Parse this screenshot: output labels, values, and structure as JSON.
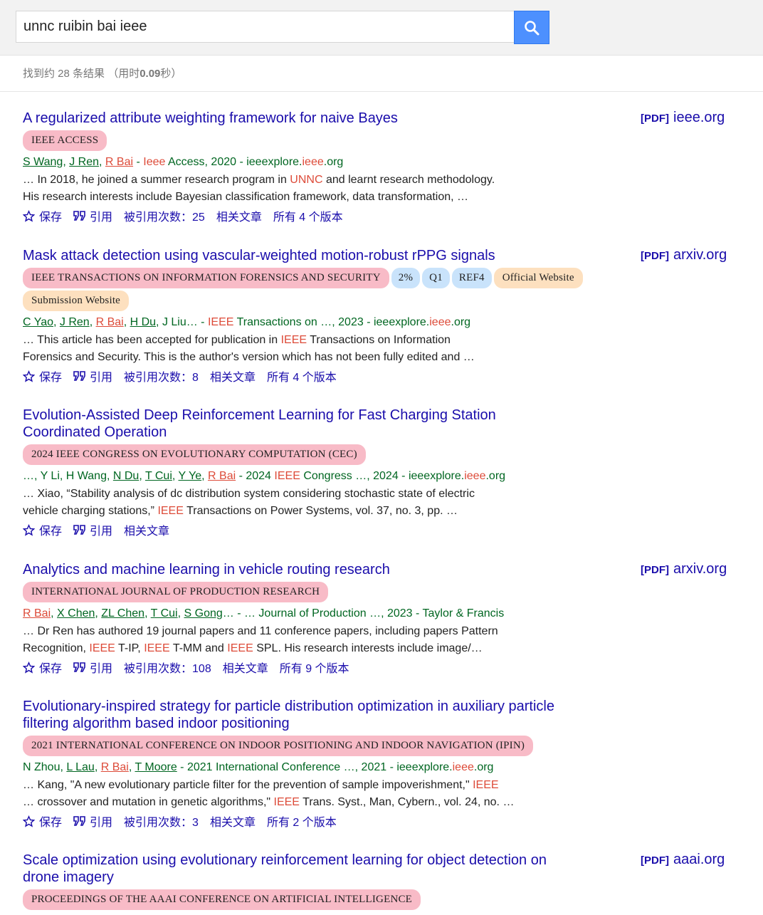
{
  "search": {
    "query": "unnc ruibin bai ieee"
  },
  "stats": {
    "prefix": "找到约 28 条结果 （用时",
    "time": "0.09",
    "suffix": "秒）"
  },
  "actions": {
    "save": "保存",
    "cite": "引用",
    "related": "相关文章"
  },
  "results": [
    {
      "title": "A regularized attribute weighting framework for naive Bayes",
      "pdf_tag": "[PDF]",
      "pdf_domain": "ieee.org",
      "badges": [
        {
          "text": "IEEE ACCESS",
          "color": "pink"
        }
      ],
      "authors": [
        {
          "t": "S Wang",
          "u": true
        },
        {
          "t": ", "
        },
        {
          "t": "J Ren",
          "u": true
        },
        {
          "t": ", "
        },
        {
          "t": "R Bai",
          "u": true,
          "hl": true
        },
        {
          "t": " - "
        },
        {
          "t": "Ieee",
          "hl": true
        },
        {
          "t": " Access, 2020 - ieeexplore."
        },
        {
          "t": "ieee",
          "hl": true
        },
        {
          "t": ".org"
        }
      ],
      "snippet": [
        [
          {
            "t": "… In 2018, he joined a summer research program in "
          },
          {
            "t": "UNNC",
            "hl": true
          },
          {
            "t": " and learnt research methodology."
          }
        ],
        [
          {
            "t": "His research interests include Bayesian classification framework, data transformation, …"
          }
        ]
      ],
      "cited": "被引用次数：25",
      "versions": "所有 4 个版本"
    },
    {
      "title": "Mask attack detection using vascular-weighted motion-robust rPPG signals",
      "pdf_tag": "[PDF]",
      "pdf_domain": "arxiv.org",
      "badges": [
        {
          "text": "IEEE TRANSACTIONS ON INFORMATION FORENSICS AND SECURITY",
          "color": "pink"
        },
        {
          "text": "2%",
          "color": "blue"
        },
        {
          "text": "Q1",
          "color": "blue"
        },
        {
          "text": "REF4",
          "color": "blue"
        },
        {
          "text": "Official Website",
          "color": "orange"
        },
        {
          "text": "Submission Website",
          "color": "orange"
        }
      ],
      "authors": [
        {
          "t": "C Yao",
          "u": true
        },
        {
          "t": ", "
        },
        {
          "t": "J Ren",
          "u": true
        },
        {
          "t": ", "
        },
        {
          "t": "R Bai",
          "u": true,
          "hl": true
        },
        {
          "t": ", "
        },
        {
          "t": "H Du",
          "u": true
        },
        {
          "t": ", J Liu… - "
        },
        {
          "t": "IEEE",
          "hl": true
        },
        {
          "t": " Transactions on …, 2023 - ieeexplore."
        },
        {
          "t": "ieee",
          "hl": true
        },
        {
          "t": ".org"
        }
      ],
      "snippet": [
        [
          {
            "t": "… This article has been accepted for publication in "
          },
          {
            "t": "IEEE",
            "hl": true
          },
          {
            "t": " Transactions on Information"
          }
        ],
        [
          {
            "t": "Forensics and Security. This is the author's version which has not been fully edited and …"
          }
        ]
      ],
      "cited": "被引用次数：8",
      "versions": "所有 4 个版本"
    },
    {
      "title": "Evolution-Assisted Deep Reinforcement Learning for Fast Charging Station Coordinated Operation",
      "pdf_tag": "",
      "pdf_domain": "",
      "badges": [
        {
          "text": "2024 IEEE CONGRESS ON EVOLUTIONARY COMPUTATION (CEC)",
          "color": "pink"
        }
      ],
      "authors": [
        {
          "t": "…, Y Li, H Wang, "
        },
        {
          "t": "N Du",
          "u": true
        },
        {
          "t": ", "
        },
        {
          "t": "T Cui",
          "u": true
        },
        {
          "t": ", "
        },
        {
          "t": "Y Ye",
          "u": true
        },
        {
          "t": ", "
        },
        {
          "t": "R Bai",
          "u": true,
          "hl": true
        },
        {
          "t": " - 2024 "
        },
        {
          "t": "IEEE",
          "hl": true
        },
        {
          "t": " Congress …, 2024 - ieeexplore."
        },
        {
          "t": "ieee",
          "hl": true
        },
        {
          "t": ".org"
        }
      ],
      "snippet": [
        [
          {
            "t": "… Xiao, “Stability analysis of dc distribution system considering stochastic state of electric"
          }
        ],
        [
          {
            "t": "vehicle charging stations,” "
          },
          {
            "t": "IEEE",
            "hl": true
          },
          {
            "t": " Transactions on Power Systems, vol. 37, no. 3, pp. …"
          }
        ]
      ],
      "cited": "",
      "versions": ""
    },
    {
      "title": "Analytics and machine learning in vehicle routing research",
      "pdf_tag": "[PDF]",
      "pdf_domain": "arxiv.org",
      "badges": [
        {
          "text": "INTERNATIONAL JOURNAL OF PRODUCTION RESEARCH",
          "color": "pink"
        }
      ],
      "authors": [
        {
          "t": "R Bai",
          "u": true,
          "hl": true
        },
        {
          "t": ", "
        },
        {
          "t": "X Chen",
          "u": true
        },
        {
          "t": ", "
        },
        {
          "t": "ZL Chen",
          "u": true
        },
        {
          "t": ", "
        },
        {
          "t": "T Cui",
          "u": true
        },
        {
          "t": ", "
        },
        {
          "t": "S Gong",
          "u": true
        },
        {
          "t": "… - … Journal of Production …, 2023 - Taylor & Francis"
        }
      ],
      "snippet": [
        [
          {
            "t": "… Dr Ren has authored 19 journal papers and 11 conference papers, including papers Pattern"
          }
        ],
        [
          {
            "t": "Recognition, "
          },
          {
            "t": "IEEE",
            "hl": true
          },
          {
            "t": " T-IP, "
          },
          {
            "t": "IEEE",
            "hl": true
          },
          {
            "t": " T-MM and "
          },
          {
            "t": "IEEE",
            "hl": true
          },
          {
            "t": " SPL. His research interests include image/…"
          }
        ]
      ],
      "cited": "被引用次数：108",
      "versions": "所有 9 个版本"
    },
    {
      "title": "Evolutionary-inspired strategy for particle distribution optimization in auxiliary particle filtering algorithm based indoor positioning",
      "pdf_tag": "",
      "pdf_domain": "",
      "badges": [
        {
          "text": "2021 INTERNATIONAL CONFERENCE ON INDOOR POSITIONING AND INDOOR NAVIGATION (IPIN)",
          "color": "pink"
        }
      ],
      "authors": [
        {
          "t": "N Zhou, "
        },
        {
          "t": "L Lau",
          "u": true
        },
        {
          "t": ", "
        },
        {
          "t": "R Bai",
          "u": true,
          "hl": true
        },
        {
          "t": ", "
        },
        {
          "t": "T Moore",
          "u": true
        },
        {
          "t": " - 2021 International Conference …, 2021 - ieeexplore."
        },
        {
          "t": "ieee",
          "hl": true
        },
        {
          "t": ".org"
        }
      ],
      "snippet": [
        [
          {
            "t": "… Kang, \"A new evolutionary particle filter for the prevention of sample impoverishment,\" "
          },
          {
            "t": "IEEE",
            "hl": true
          }
        ],
        [
          {
            "t": "… crossover and mutation in genetic algorithms,\" "
          },
          {
            "t": "IEEE",
            "hl": true
          },
          {
            "t": " Trans. Syst., Man, Cybern., vol. 24, no. …"
          }
        ]
      ],
      "cited": "被引用次数：3",
      "versions": "所有 2 个版本"
    },
    {
      "title": "Scale optimization using evolutionary reinforcement learning for object detection on drone imagery",
      "pdf_tag": "[PDF]",
      "pdf_domain": "aaai.org",
      "badges": [
        {
          "text": "PROCEEDINGS OF THE AAAI CONFERENCE ON ARTIFICIAL INTELLIGENCE",
          "color": "pink"
        }
      ],
      "authors": [],
      "snippet": [],
      "cited": "",
      "versions": ""
    }
  ]
}
